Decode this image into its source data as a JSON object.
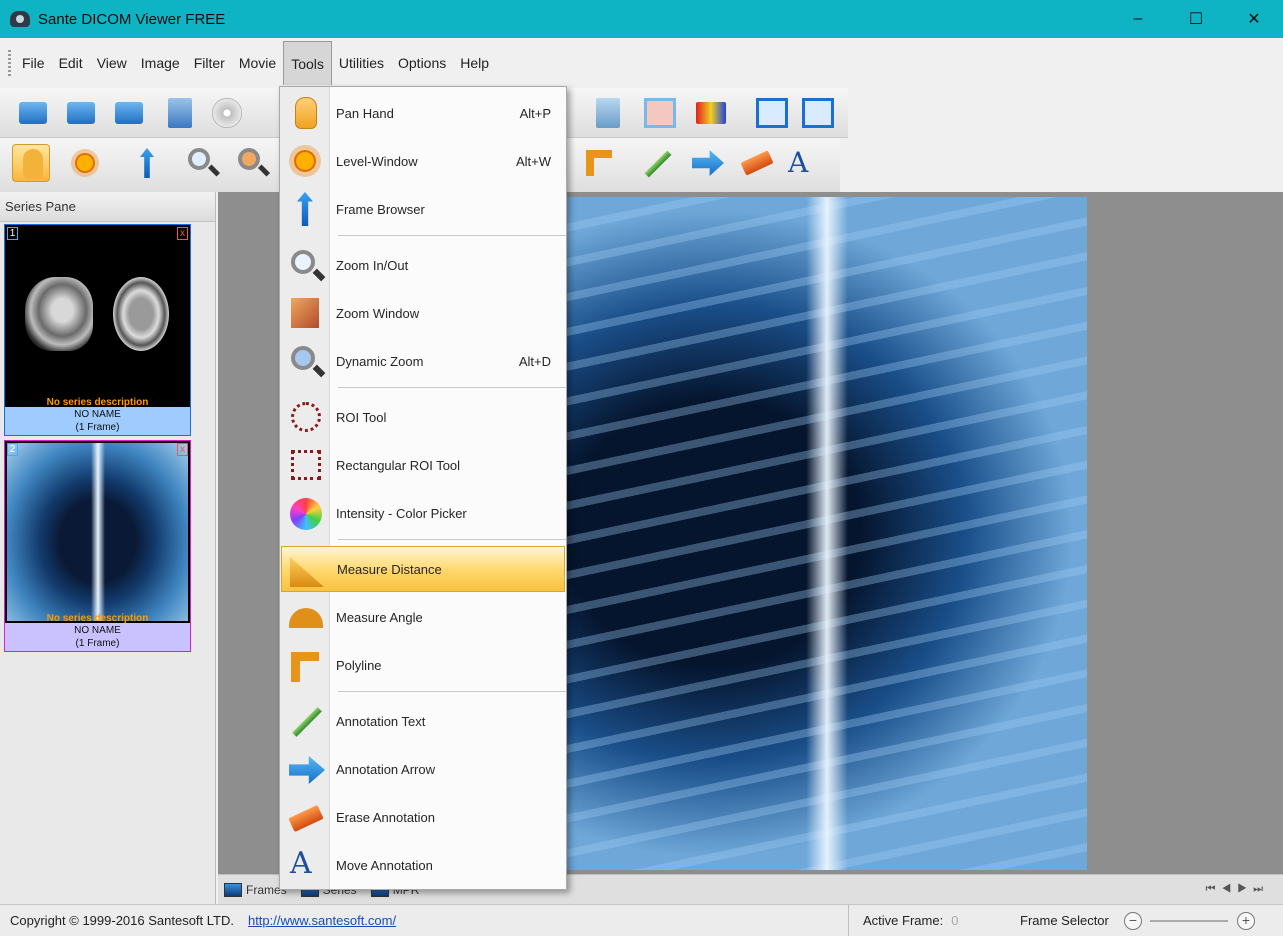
{
  "window": {
    "title": "Sante DICOM Viewer FREE",
    "minimize": "–",
    "maximize": "☐",
    "close": "✕"
  },
  "menu": [
    "File",
    "Edit",
    "View",
    "Image",
    "Filter",
    "Movie",
    "Tools",
    "Utilities",
    "Options",
    "Help"
  ],
  "tools_menu": {
    "items": [
      {
        "label": "Pan Hand",
        "shortcut": "Alt+P",
        "icon": "pan-hand-icon"
      },
      {
        "label": "Level-Window",
        "shortcut": "Alt+W",
        "icon": "level-window-icon"
      },
      {
        "label": "Frame Browser",
        "shortcut": "",
        "icon": "frame-browser-icon"
      },
      {
        "label": "Zoom In/Out",
        "shortcut": "",
        "icon": "zoom-icon"
      },
      {
        "label": "Zoom Window",
        "shortcut": "",
        "icon": "zoom-window-icon"
      },
      {
        "label": "Dynamic Zoom",
        "shortcut": "Alt+D",
        "icon": "dynamic-zoom-icon"
      },
      {
        "label": "ROI Tool",
        "shortcut": "",
        "icon": "roi-icon"
      },
      {
        "label": "Rectangular ROI Tool",
        "shortcut": "",
        "icon": "rect-roi-icon"
      },
      {
        "label": "Intensity - Color Picker",
        "shortcut": "",
        "icon": "color-picker-icon"
      },
      {
        "label": "Measure Distance",
        "shortcut": "",
        "icon": "measure-distance-icon",
        "highlighted": true
      },
      {
        "label": "Measure Angle",
        "shortcut": "",
        "icon": "measure-angle-icon"
      },
      {
        "label": "Polyline",
        "shortcut": "",
        "icon": "polyline-icon"
      },
      {
        "label": "Annotation Text",
        "shortcut": "",
        "icon": "annotation-text-icon"
      },
      {
        "label": "Annotation Arrow",
        "shortcut": "",
        "icon": "annotation-arrow-icon"
      },
      {
        "label": "Erase Annotation",
        "shortcut": "",
        "icon": "erase-annotation-icon"
      },
      {
        "label": "Move Annotation",
        "shortcut": "",
        "icon": "move-annotation-icon"
      }
    ]
  },
  "series_pane": {
    "title": "Series Pane",
    "items": [
      {
        "index": "1",
        "close": "x",
        "description": "No series description",
        "name": "NO NAME",
        "frames": "(1 Frame)"
      },
      {
        "index": "2",
        "close": "x",
        "description": "No series description",
        "name": "NO NAME",
        "frames": "(1 Frame)"
      }
    ]
  },
  "bottom_tabs": {
    "frames": "Frames",
    "series": "Series",
    "mpr": "MPR"
  },
  "status": {
    "copyright": "Copyright © 1999-2016 Santesoft LTD.",
    "link": "http://www.santesoft.com/",
    "active_frame_label": "Active Frame:",
    "active_frame_value": "0",
    "frame_selector_label": "Frame Selector",
    "zoom_minus": "−",
    "zoom_plus": "+"
  },
  "colors": {
    "titlebar": "#0fb4c4",
    "highlight": "#ffd66a",
    "link": "#1a4ab8"
  }
}
